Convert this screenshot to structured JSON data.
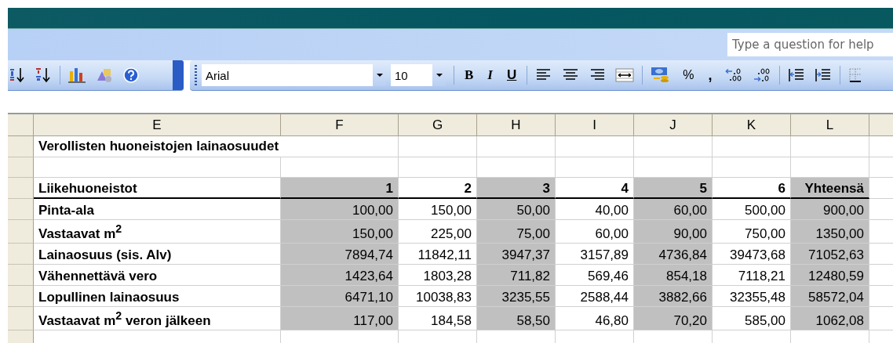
{
  "help_box": {
    "placeholder": "Type a question for help"
  },
  "formatting_toolbar": {
    "font_name": "Arial",
    "font_size": "10",
    "bold": "B",
    "italic": "I",
    "underline": "U",
    "percent": "%",
    "comma": ","
  },
  "sheet": {
    "columns": [
      "E",
      "F",
      "G",
      "H",
      "I",
      "J",
      "K",
      "L"
    ],
    "rows": [
      {
        "kind": "title",
        "label": "Verollisten huoneistojen lainaosuudet"
      },
      {
        "kind": "blank"
      },
      {
        "kind": "header",
        "label": "Liikehuoneistot",
        "values": [
          {
            "text": "1",
            "shaded": true
          },
          {
            "text": "2",
            "shaded": false
          },
          {
            "text": "3",
            "shaded": true
          },
          {
            "text": "4",
            "shaded": false
          },
          {
            "text": "5",
            "shaded": true
          },
          {
            "text": "6",
            "shaded": false
          },
          {
            "text": "Yhteensä",
            "shaded": true
          }
        ]
      },
      {
        "kind": "data",
        "label": "Pinta-ala",
        "values": [
          {
            "text": "100,00",
            "shaded": true
          },
          {
            "text": "150,00",
            "shaded": false
          },
          {
            "text": "50,00",
            "shaded": true
          },
          {
            "text": "40,00",
            "shaded": false
          },
          {
            "text": "60,00",
            "shaded": true
          },
          {
            "text": "500,00",
            "shaded": false
          },
          {
            "text": "900,00",
            "shaded": true
          }
        ]
      },
      {
        "kind": "data",
        "label": "Vastaavat m$^{2}$",
        "values": [
          {
            "text": "150,00",
            "shaded": true
          },
          {
            "text": "225,00",
            "shaded": false
          },
          {
            "text": "75,00",
            "shaded": true
          },
          {
            "text": "60,00",
            "shaded": false
          },
          {
            "text": "90,00",
            "shaded": true
          },
          {
            "text": "750,00",
            "shaded": false
          },
          {
            "text": "1350,00",
            "shaded": true
          }
        ]
      },
      {
        "kind": "data",
        "label": "Lainaosuus (sis. Alv)",
        "values": [
          {
            "text": "7894,74",
            "shaded": true
          },
          {
            "text": "11842,11",
            "shaded": false
          },
          {
            "text": "3947,37",
            "shaded": true
          },
          {
            "text": "3157,89",
            "shaded": false
          },
          {
            "text": "4736,84",
            "shaded": true
          },
          {
            "text": "39473,68",
            "shaded": false
          },
          {
            "text": "71052,63",
            "shaded": true
          }
        ]
      },
      {
        "kind": "data",
        "label": "Vähennettävä vero",
        "values": [
          {
            "text": "1423,64",
            "shaded": true
          },
          {
            "text": "1803,28",
            "shaded": false
          },
          {
            "text": "711,82",
            "shaded": true
          },
          {
            "text": "569,46",
            "shaded": false
          },
          {
            "text": "854,18",
            "shaded": true
          },
          {
            "text": "7118,21",
            "shaded": false
          },
          {
            "text": "12480,59",
            "shaded": true
          }
        ]
      },
      {
        "kind": "data",
        "label": "Lopullinen lainaosuus",
        "values": [
          {
            "text": "6471,10",
            "shaded": true
          },
          {
            "text": "10038,83",
            "shaded": false
          },
          {
            "text": "3235,55",
            "shaded": true
          },
          {
            "text": "2588,44",
            "shaded": false
          },
          {
            "text": "3882,66",
            "shaded": true
          },
          {
            "text": "32355,48",
            "shaded": false
          },
          {
            "text": "58572,04",
            "shaded": true
          }
        ]
      },
      {
        "kind": "data",
        "label": "Vastaavat m$^{2}$ veron jälkeen",
        "values": [
          {
            "text": "117,00",
            "shaded": true
          },
          {
            "text": "184,58",
            "shaded": false
          },
          {
            "text": "58,50",
            "shaded": true
          },
          {
            "text": "46,80",
            "shaded": false
          },
          {
            "text": "70,20",
            "shaded": true
          },
          {
            "text": "585,00",
            "shaded": false
          },
          {
            "text": "1062,08",
            "shaded": true
          }
        ]
      },
      {
        "kind": "blank"
      }
    ]
  }
}
